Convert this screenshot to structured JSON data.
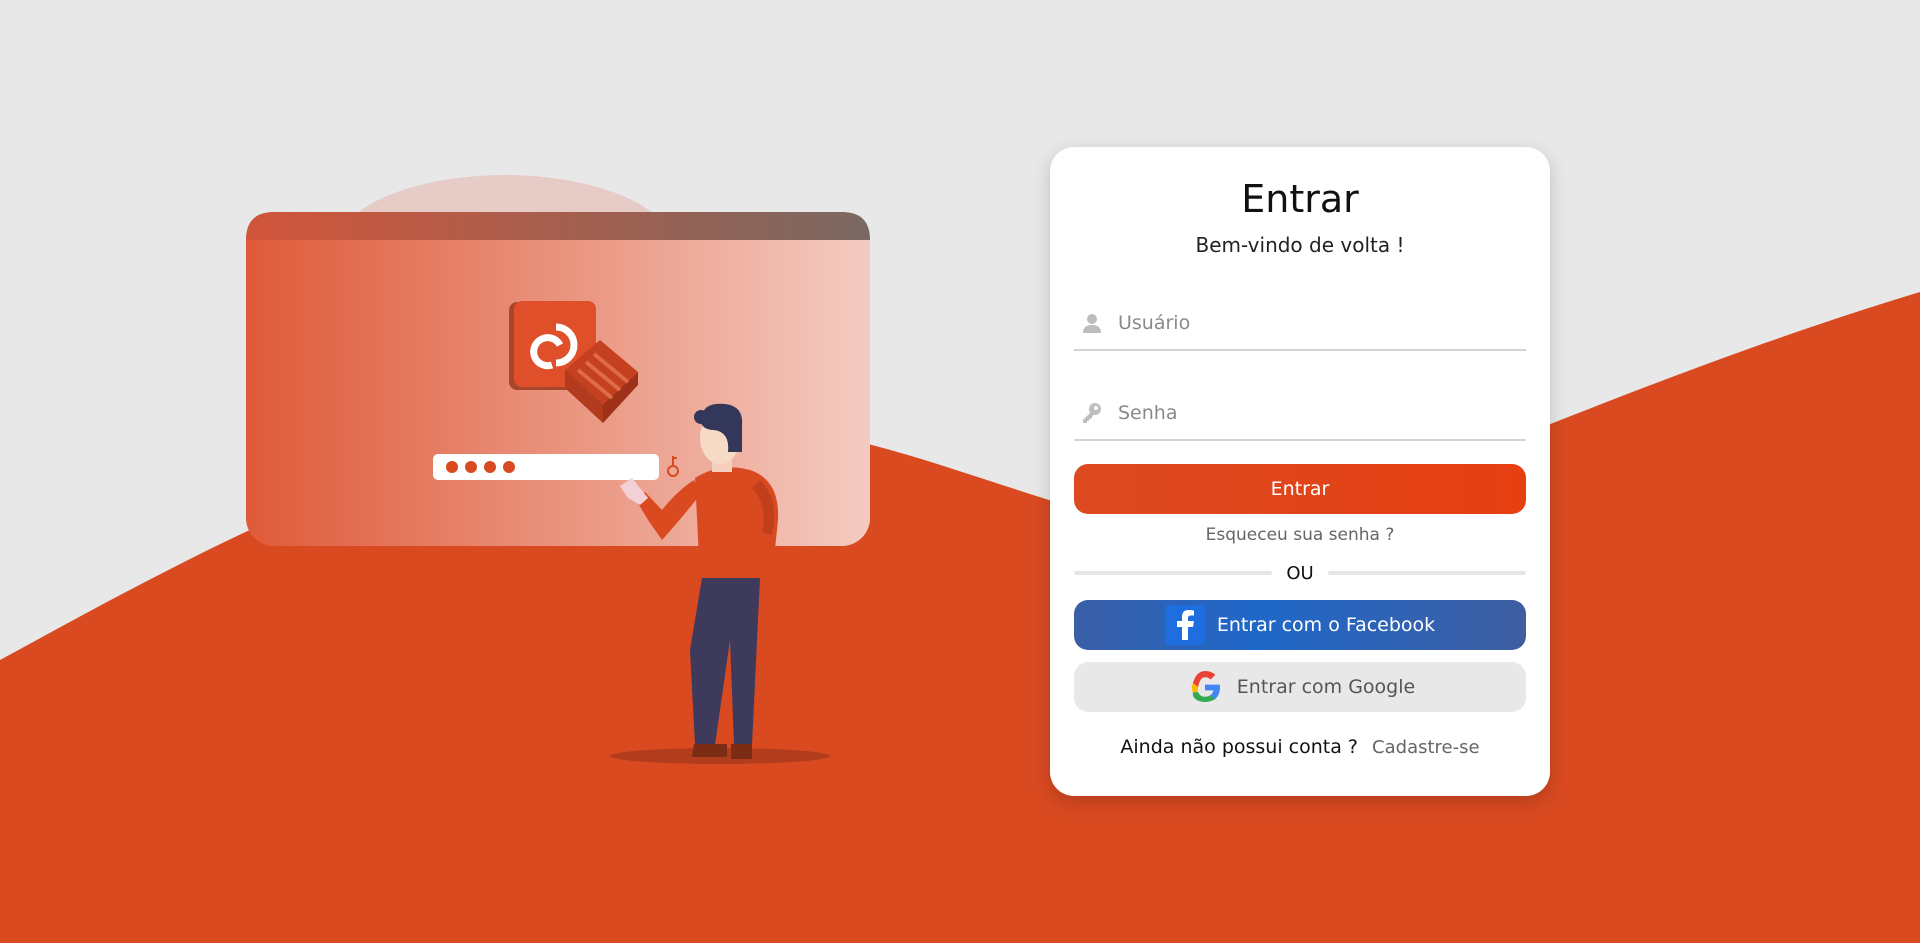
{
  "login": {
    "title": "Entrar",
    "subtitle": "Bem-vindo de volta !",
    "username_placeholder": "Usuário",
    "password_placeholder": "Senha",
    "submit_label": "Entrar",
    "forgot_label": "Esqueceu sua senha ?",
    "divider_label": "OU",
    "facebook_label": "Entrar com o Facebook",
    "google_label": "Entrar com Google",
    "signup_prompt": "Ainda não possui conta ?",
    "signup_link": "Cadastre-se"
  },
  "icons": {
    "username": "user-icon",
    "password": "key-icon",
    "facebook": "facebook-icon",
    "google": "google-icon"
  },
  "colors": {
    "accent": "#d94a21",
    "background": "#e8e8e8",
    "facebook": "#3a5fa6",
    "google_button": "#e8e8e8"
  }
}
